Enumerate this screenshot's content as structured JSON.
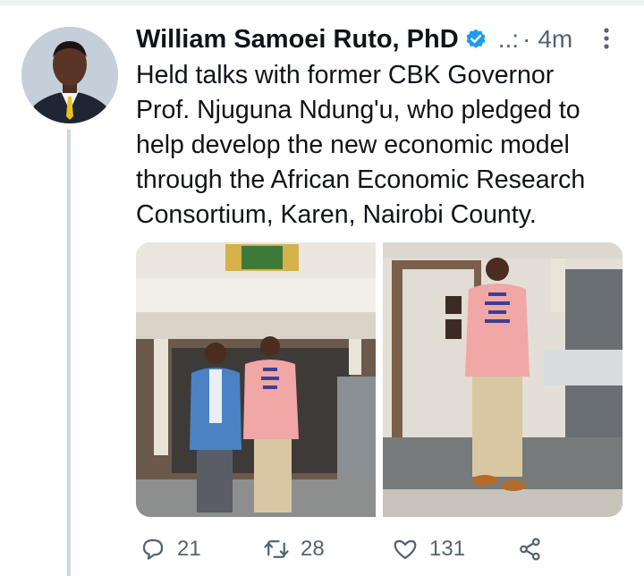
{
  "tweet": {
    "author_name": "William Samoei Ruto, PhD",
    "handle_truncated": "..:",
    "separator": "·",
    "timestamp": "4m",
    "text": "Held talks with former CBK Governor\nProf. Njuguna Ndung'u, who pledged to\nhelp develop the new economic model\nthrough the African Economic Research\nConsortium, Karen, Nairobi County.",
    "verified": true,
    "accent_color": "#1d9bf0"
  },
  "media": [
    {
      "icon": "photo-two-men-at-entrance"
    },
    {
      "icon": "photo-man-standing-in-lobby"
    }
  ],
  "actions": {
    "reply_count": "21",
    "retweet_count": "28",
    "like_count": "131",
    "icons": [
      "reply-icon",
      "retweet-icon",
      "like-icon",
      "share-icon"
    ]
  },
  "colors": {
    "text_primary": "#0f1419",
    "text_secondary": "#536471",
    "thread_line": "#cfd9de"
  }
}
